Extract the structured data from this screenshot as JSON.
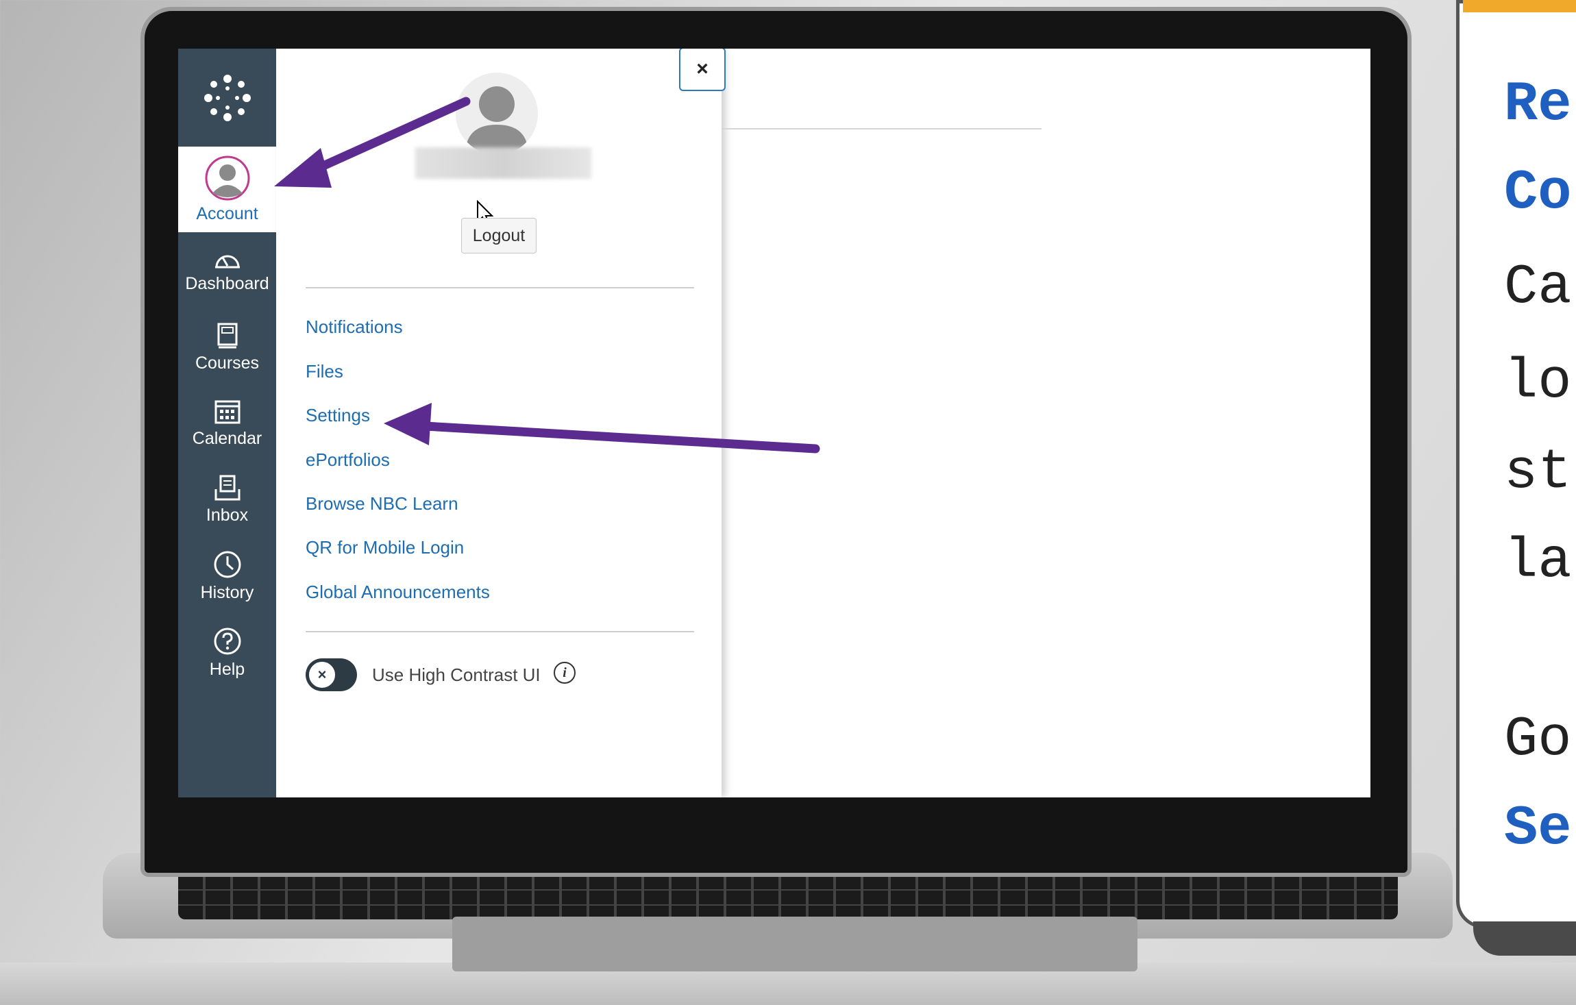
{
  "nav": {
    "account_label": "Account",
    "items": [
      {
        "label": "Dashboard",
        "icon": "dashboard-icon"
      },
      {
        "label": "Courses",
        "icon": "courses-icon"
      },
      {
        "label": "Calendar",
        "icon": "calendar-icon"
      },
      {
        "label": "Inbox",
        "icon": "inbox-icon"
      },
      {
        "label": "History",
        "icon": "history-icon"
      },
      {
        "label": "Help",
        "icon": "help-icon"
      }
    ]
  },
  "tray": {
    "close_label": "×",
    "logout_label": "Logout",
    "links": [
      "Notifications",
      "Files",
      "Settings",
      "ePortfolios",
      "Browse NBC Learn",
      "QR for Mobile Login",
      "Global Announcements"
    ],
    "high_contrast_label": "Use High Contrast UI",
    "toggle_symbol": "×",
    "info_symbol": "i"
  },
  "card": {
    "lines": [
      "Re",
      "Co",
      "Ca",
      "lo",
      "st",
      "la",
      "Go",
      "Se"
    ]
  },
  "colors": {
    "nav_bg": "#394b58",
    "link": "#1d6db0",
    "arrow": "#5b2b8f",
    "card_accent": "#f0a92a",
    "card_heading": "#1f5fbf"
  }
}
